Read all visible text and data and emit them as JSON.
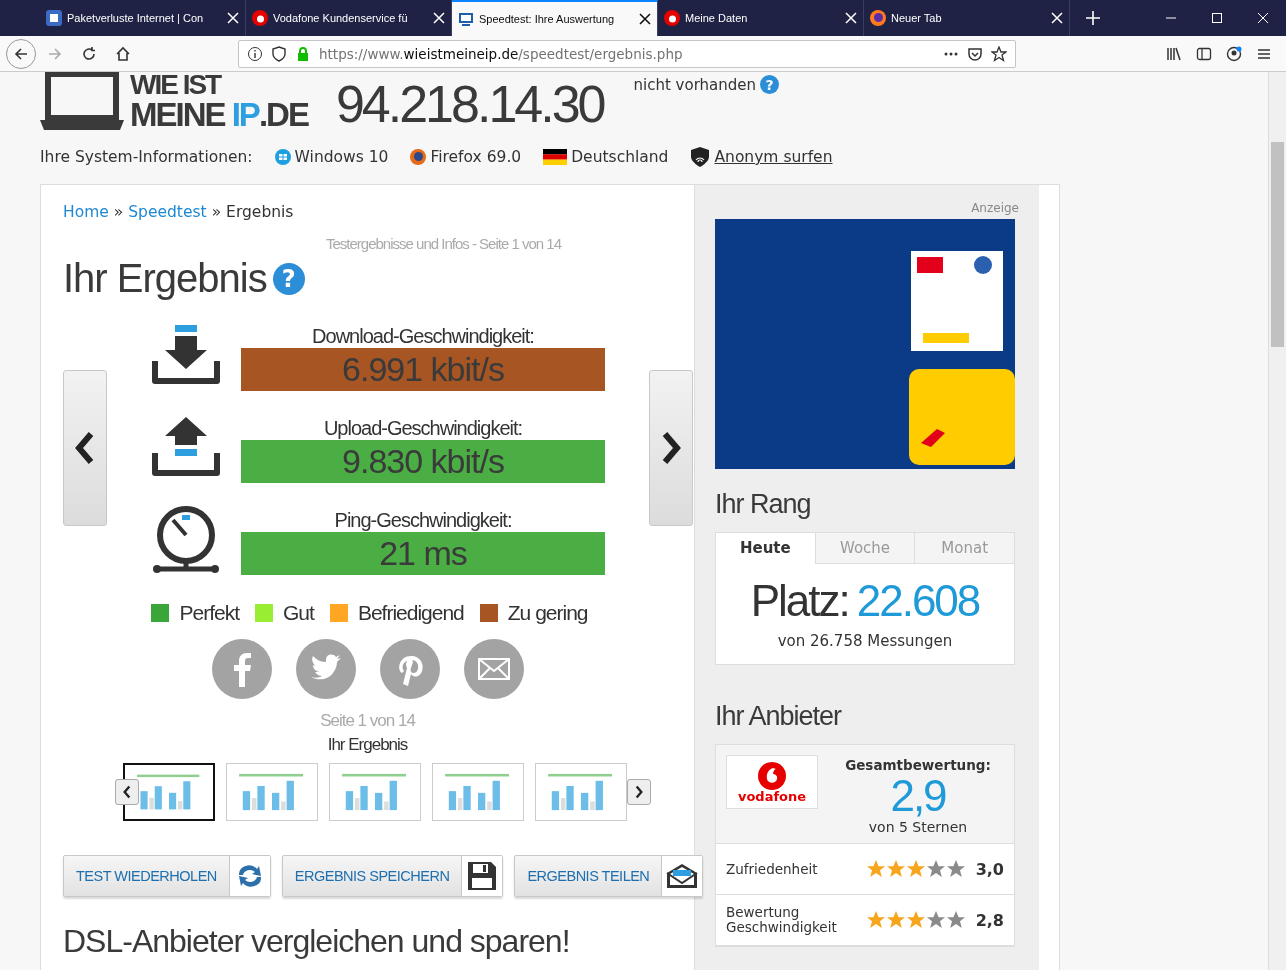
{
  "browser": {
    "tabs": [
      {
        "title": "Paketverluste Internet | Con",
        "kind": "cb",
        "selected": false
      },
      {
        "title": "Vodafone Kundenservice fü",
        "kind": "vodafone",
        "selected": false
      },
      {
        "title": "Speedtest: Ihre Auswertung",
        "kind": "monitor",
        "selected": true
      },
      {
        "title": "Meine Daten",
        "kind": "vodafone",
        "selected": false
      },
      {
        "title": "Neuer Tab",
        "kind": "firefox",
        "selected": false
      }
    ],
    "url_prefix": "https://www.",
    "url_domain": "wieistmeineip.de",
    "url_path": "/speedtest/ergebnis.php"
  },
  "header": {
    "logo_top": "WIE IST",
    "logo_bottom": "MEINE **IP**.DE",
    "ip": "94.218.14.30",
    "ipv6": "nicht vorhanden",
    "help": "?",
    "system_label": "Ihre System-Informationen:",
    "system": [
      {
        "kind": "windows",
        "text": "Windows 10"
      },
      {
        "kind": "firefox",
        "text": "Firefox 69.0"
      },
      {
        "kind": "flag",
        "text": "Deutschland"
      },
      {
        "kind": "vpn",
        "text": "Anonym surfen"
      }
    ]
  },
  "breadcrumb": [
    {
      "kind": "link",
      "text": "Home"
    },
    {
      "kind": "sep",
      "text": "»"
    },
    {
      "kind": "link",
      "text": "Speedtest"
    },
    {
      "kind": "sep",
      "text": "»"
    },
    {
      "kind": "current",
      "text": "Ergebnis"
    }
  ],
  "subtitle": "Testergebnisse und Infos - Seite 1 von 14",
  "title": "Ihr Ergebnis",
  "title_help": "?",
  "results": [
    {
      "kind": "download",
      "label": "Download-Geschwindigkeit:",
      "value": "6.991 kbit/s",
      "color": "#a65523"
    },
    {
      "kind": "upload",
      "label": "Upload-Geschwindigkeit:",
      "value": "9.830 kbit/s",
      "color": "#4aae44"
    },
    {
      "kind": "ping",
      "label": "Ping-Geschwindigkeit:",
      "value": "21 ms",
      "color": "#4aae44"
    }
  ],
  "legend": [
    {
      "label": "Perfekt",
      "color": "#3aa63a"
    },
    {
      "label": "Gut",
      "color": "#99ee33"
    },
    {
      "label": "Befriedigend",
      "color": "#ffa623"
    },
    {
      "label": "Zu gering",
      "color": "#a65523"
    }
  ],
  "share": [
    {
      "kind": "facebook"
    },
    {
      "kind": "twitter"
    },
    {
      "kind": "pinterest"
    },
    {
      "kind": "mail"
    }
  ],
  "page_info": "Seite 1 von 14",
  "page_title": "Ihr Ergebnis",
  "thumbnails": [
    {
      "selected": true
    },
    {
      "selected": false
    },
    {
      "selected": false
    },
    {
      "selected": false
    },
    {
      "selected": false
    }
  ],
  "buttons": [
    {
      "label": "**TEST** WIEDERHOLEN",
      "kind": "refresh"
    },
    {
      "label": "**ERGEBNIS** SPEICHERN",
      "kind": "save"
    },
    {
      "label": "**ERGEBNIS** TEILEN",
      "kind": "mail"
    }
  ],
  "section_heading": "DSL-Anbieter vergleichen und sparen!",
  "sidebar": {
    "ad_label": "Anzeige",
    "rank_title": "Ihr Rang",
    "rank_tabs": [
      {
        "label": "Heute",
        "selected": true
      },
      {
        "label": "Woche",
        "selected": false
      },
      {
        "label": "Monat",
        "selected": false
      }
    ],
    "rank_label": "Platz:",
    "rank_value": "22.608",
    "rank_note": "von 26.758 Messungen",
    "provider_title": "Ihr Anbieter",
    "provider_logo": "vodafone",
    "overall_label": "Gesamtbewertung:",
    "overall_value": "2,9",
    "overall_note": "von 5 Sternen",
    "ratings": [
      {
        "label": "Zufriedenheit",
        "stars": 3,
        "value": "3,0"
      },
      {
        "label": "Bewertung Geschwindigkeit",
        "stars": 3,
        "value": "2,8"
      }
    ]
  }
}
